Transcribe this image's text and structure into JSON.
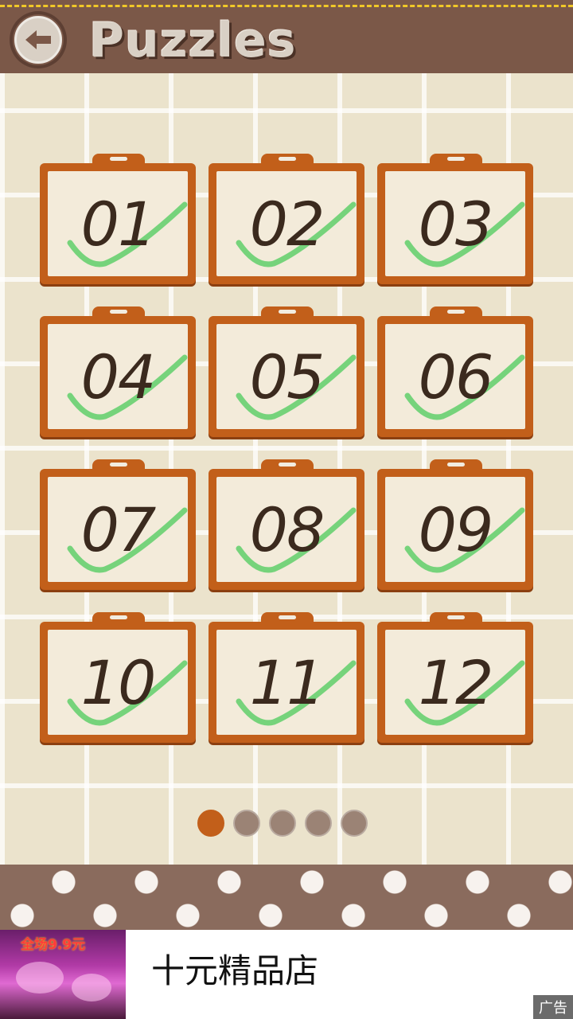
{
  "header": {
    "title": "Puzzles",
    "back_icon": "back-arrow-icon"
  },
  "levels": [
    {
      "label": "01",
      "completed": true
    },
    {
      "label": "02",
      "completed": true
    },
    {
      "label": "03",
      "completed": true
    },
    {
      "label": "04",
      "completed": true
    },
    {
      "label": "05",
      "completed": true
    },
    {
      "label": "06",
      "completed": true
    },
    {
      "label": "07",
      "completed": true
    },
    {
      "label": "08",
      "completed": true
    },
    {
      "label": "09",
      "completed": true
    },
    {
      "label": "10",
      "completed": true
    },
    {
      "label": "11",
      "completed": true
    },
    {
      "label": "12",
      "completed": true
    }
  ],
  "pagination": {
    "pages": 5,
    "current": 1
  },
  "ad": {
    "banner_text": "全场9.9元",
    "title": "十元精品店",
    "tag": "广告"
  },
  "colors": {
    "header": "#7b5848",
    "card_frame": "#c25f1a",
    "check": "#5fcf6a",
    "active_dot": "#c25f1a",
    "inactive_dot": "#9b8375"
  }
}
